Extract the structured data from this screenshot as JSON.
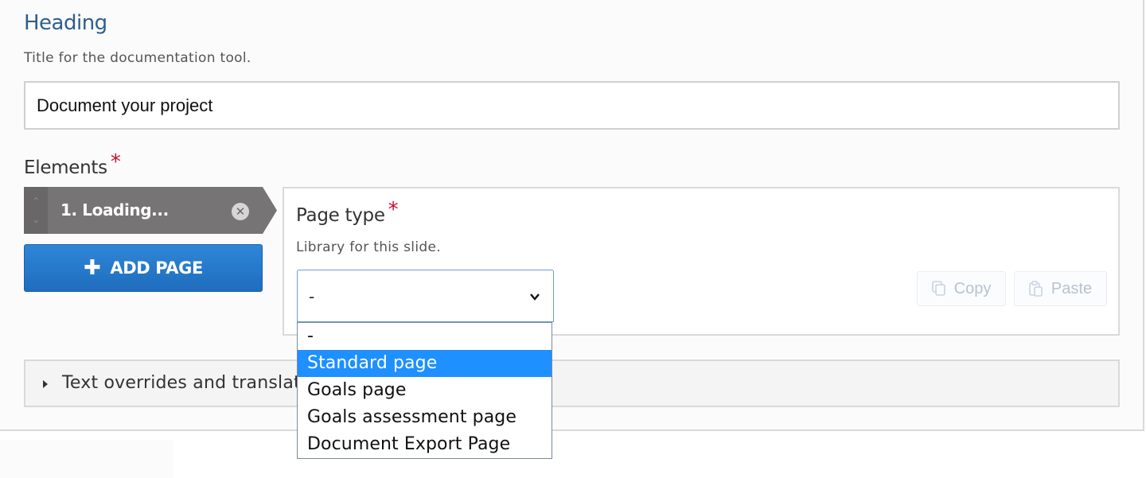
{
  "heading": {
    "title": "Heading",
    "description": "Title for the documentation tool.",
    "input_value": "Document your project"
  },
  "elements": {
    "label": "Elements",
    "required_mark": "*",
    "items": [
      {
        "label": "1. Loading..."
      }
    ],
    "add_page_label": "ADD PAGE"
  },
  "page_type": {
    "label": "Page type",
    "required_mark": "*",
    "description": "Library for this slide.",
    "selected_value": "-",
    "copy_label": "Copy",
    "paste_label": "Paste",
    "options": [
      "-",
      "Standard page",
      "Goals page",
      "Goals assessment page",
      "Document Export Page"
    ],
    "highlighted_option": "Standard page"
  },
  "overrides": {
    "label": "Text overrides and translat"
  },
  "icons": {
    "order_up": "chevron-up-icon",
    "order_down": "chevron-down-icon",
    "remove": "close-circle-icon",
    "add": "plus-icon",
    "select_chevron": "chevron-down-icon",
    "copy": "copy-icon",
    "paste": "paste-icon",
    "expand": "caret-right-icon"
  },
  "colors": {
    "heading": "#2f5f8f",
    "required": "#c8102e",
    "primary_button": "#1f6dbf",
    "list_item": "#6a6768",
    "dropdown_highlight": "#1e90ff"
  }
}
